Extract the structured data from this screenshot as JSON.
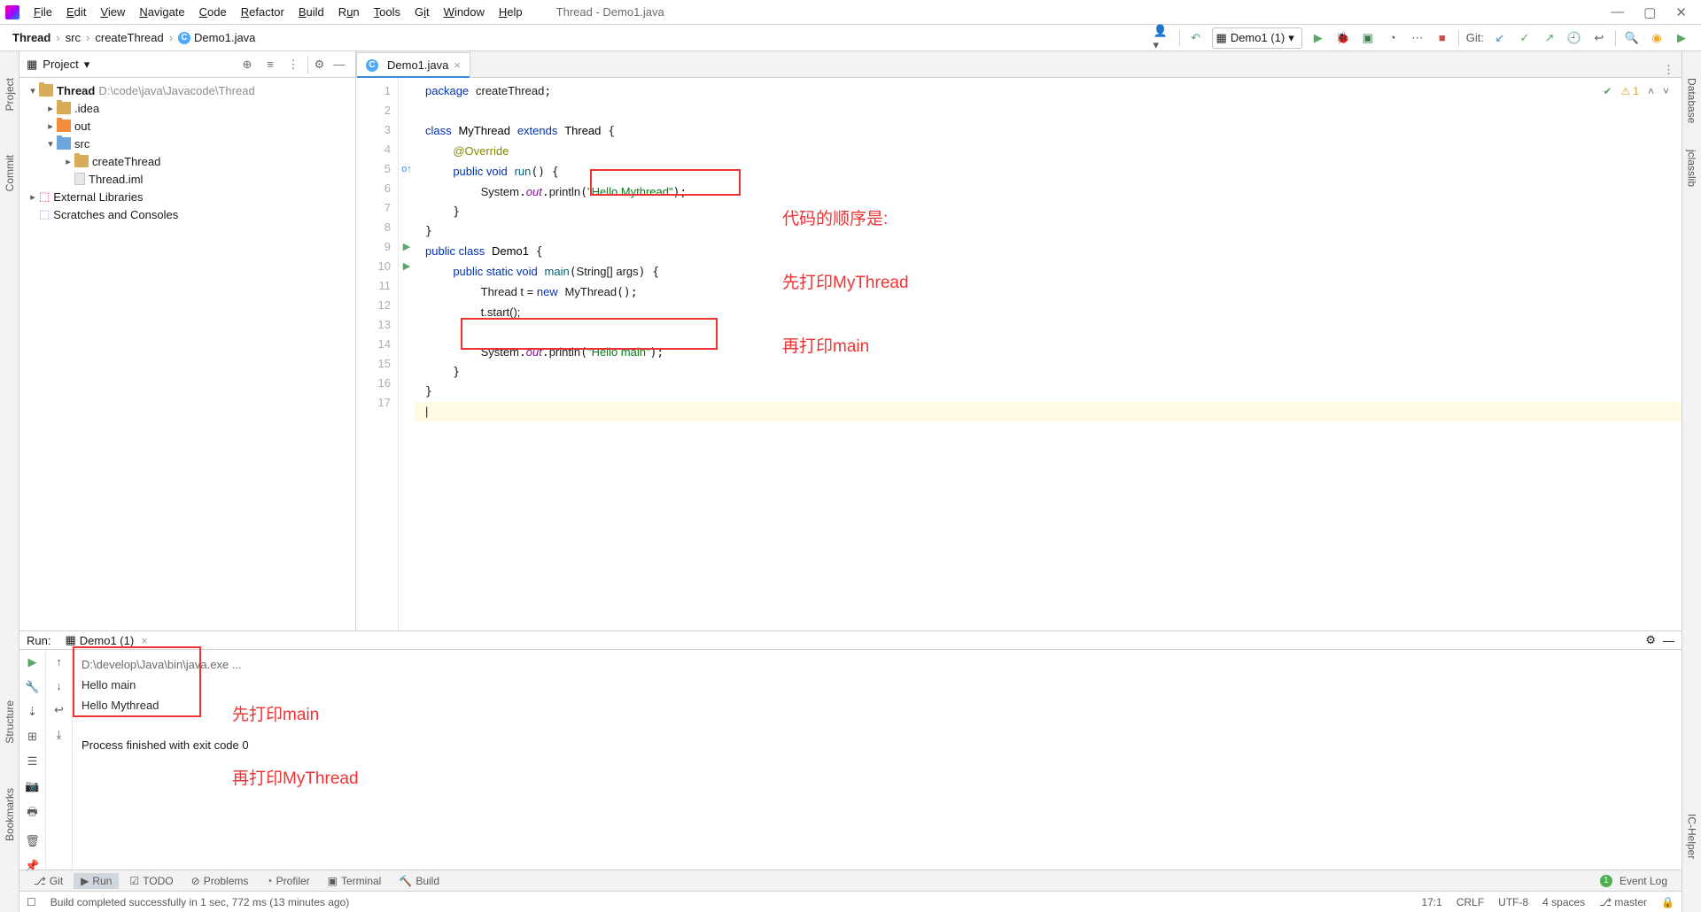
{
  "window": {
    "title": "Thread - Demo1.java"
  },
  "menu": [
    "File",
    "Edit",
    "View",
    "Navigate",
    "Code",
    "Refactor",
    "Build",
    "Run",
    "Tools",
    "Git",
    "Window",
    "Help"
  ],
  "breadcrumbs": {
    "root": "Thread",
    "p1": "src",
    "p2": "createThread",
    "file": "Demo1.java"
  },
  "toolbar": {
    "run_config": "Demo1 (1)",
    "git_label": "Git:"
  },
  "project": {
    "title": "Project",
    "root": {
      "name": "Thread",
      "path": "D:\\code\\java\\Javacode\\Thread"
    },
    "nodes": {
      "idea": ".idea",
      "out": "out",
      "src": "src",
      "create": "createThread",
      "iml": "Thread.iml",
      "ext": "External Libraries",
      "scr": "Scratches and Consoles"
    }
  },
  "editor": {
    "tab": "Demo1.java",
    "lines": [
      "1",
      "2",
      "3",
      "4",
      "5",
      "6",
      "7",
      "8",
      "9",
      "10",
      "11",
      "12",
      "13",
      "14",
      "15",
      "16",
      "17"
    ],
    "code": {
      "l1_pkg": "package",
      "l1_name": "createThread",
      "l3_cls": "class",
      "l3_name": "MyThread",
      "l3_ext": "extends",
      "l3_sup": "Thread",
      "l4_ann": "@Override",
      "l5_mod": "public void",
      "l5_meth": "run",
      "l6_sys": "System",
      "l6_out": "out",
      "l6_pr": "println",
      "l6_str": "\"Hello Mythread\"",
      "l9_mod": "public class",
      "l9_name": "Demo1",
      "l10_mod": "public static void",
      "l10_meth": "main",
      "l10_arg": "String[] args",
      "l11_th": "Thread t = ",
      "l11_new": "new",
      "l11_cls": "MyThread",
      "l12": "t.start();",
      "l14_sys": "System",
      "l14_out": "out",
      "l14_pr": "println",
      "l14_str": "\"Hello main\""
    },
    "annotation": {
      "top1": "代码的顺序是:",
      "top2": "先打印MyThread",
      "top3": "再打印main"
    },
    "inspection": {
      "warn_count": "1"
    }
  },
  "run": {
    "label": "Run:",
    "tab": "Demo1 (1)",
    "console": {
      "cmd": "D:\\develop\\Java\\bin\\java.exe ...",
      "o1": "Hello main",
      "o2": "Hello Mythread",
      "exit": "Process finished with exit code 0"
    },
    "annotation": {
      "a1": "先打印main",
      "a2": "再打印MyThread"
    }
  },
  "bottom_tools": {
    "git": "Git",
    "run": "Run",
    "todo": "TODO",
    "problems": "Problems",
    "profiler": "Profiler",
    "terminal": "Terminal",
    "build": "Build",
    "event": "Event Log"
  },
  "status": {
    "msg": "Build completed successfully in 1 sec, 772 ms (13 minutes ago)",
    "pos": "17:1",
    "sep": "CRLF",
    "enc": "UTF-8",
    "indent": "4 spaces",
    "branch": "master"
  },
  "left_tools": {
    "project": "Project",
    "commit": "Commit",
    "structure": "Structure",
    "bookmarks": "Bookmarks"
  },
  "right_tools": {
    "db": "Database",
    "jc": "jclasslib",
    "ic": "IC-Helper"
  }
}
